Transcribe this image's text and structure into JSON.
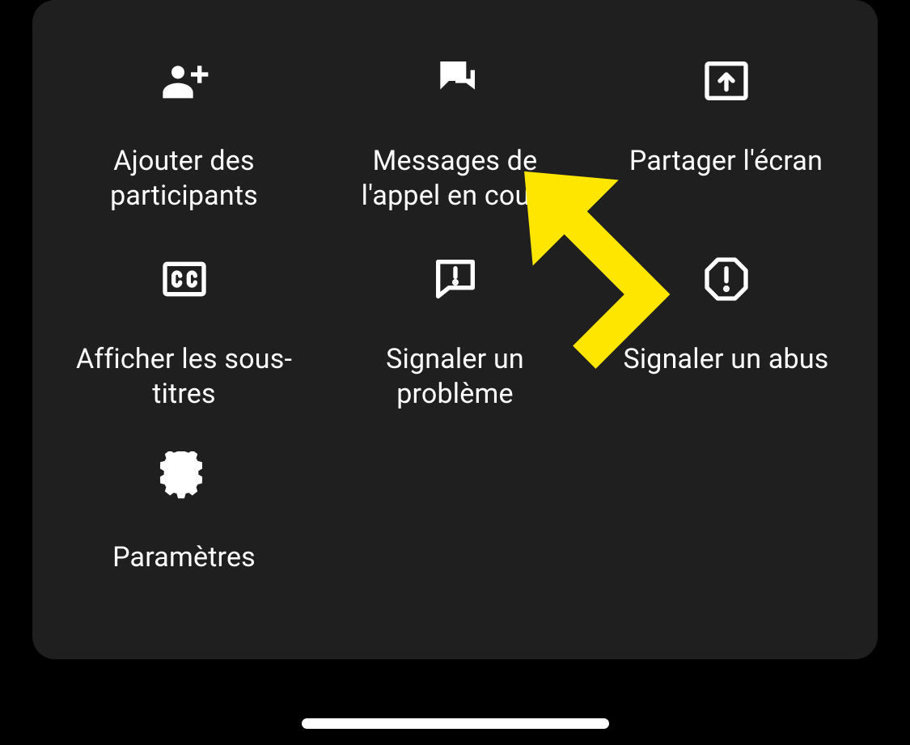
{
  "menu": {
    "items": [
      {
        "label": "Ajouter des participants"
      },
      {
        "label": "Messages de l'appel en cou…"
      },
      {
        "label": "Partager l'écran"
      },
      {
        "label": "Afficher les sous-titres"
      },
      {
        "label": "Signaler un problème"
      },
      {
        "label": "Signaler un abus"
      },
      {
        "label": "Paramètres"
      }
    ]
  },
  "annotation": {
    "arrow_color": "#ffe600"
  }
}
